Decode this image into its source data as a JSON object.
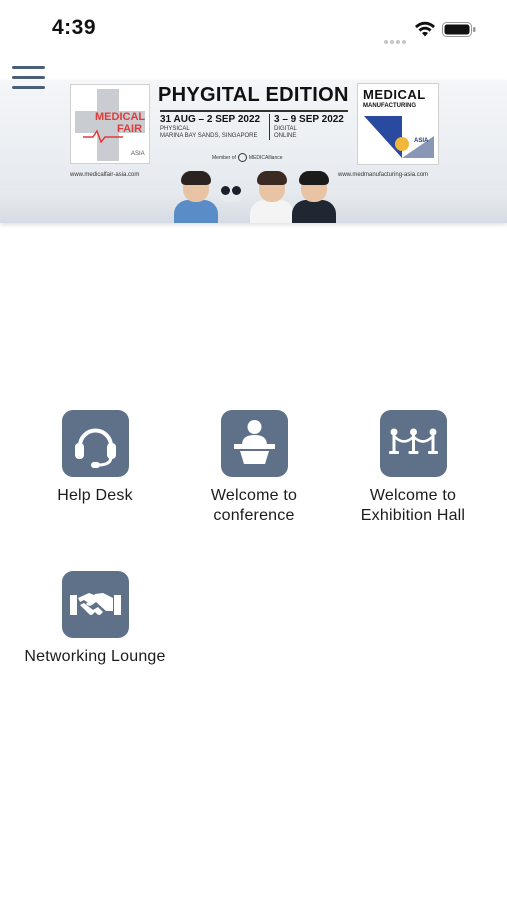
{
  "status_bar": {
    "time": "4:39",
    "icons": [
      "signal-dots-icon",
      "wifi-icon",
      "battery-icon"
    ]
  },
  "header": {
    "menu_icon": "hamburger-menu-icon"
  },
  "banner": {
    "left_logo": {
      "line1": "MEDICAL",
      "line2": "FAIR",
      "line3": "ASIA",
      "url": "www.medicalfair-asia.com"
    },
    "edition_title": "PHYGITAL EDITION",
    "physical": {
      "dates": "31 AUG – 2 SEP 2022",
      "line1": "PHYSICAL",
      "line2": "MARINA BAY SANDS, SINGAPORE"
    },
    "digital": {
      "dates": "3 – 9 SEP 2022",
      "line1": "DIGITAL",
      "line2": "ONLINE"
    },
    "member_text": "Member of",
    "member_brand": "MEDICAlliance",
    "right_logo": {
      "line1": "MEDICAL",
      "line2": "MANUFACTURING",
      "line3": "ASIA",
      "url": "www.medmanufacturing-asia.com"
    }
  },
  "menu_tiles": [
    {
      "label": "Help Desk",
      "icon": "headset-icon"
    },
    {
      "label_line1": "Welcome to",
      "label_line2": "conference",
      "icon": "podium-speaker-icon"
    },
    {
      "label_line1": "Welcome to",
      "label_line2": "Exhibition Hall",
      "icon": "stanchion-rope-icon"
    },
    {
      "label": "Networking Lounge",
      "icon": "handshake-icon"
    }
  ],
  "colors": {
    "tile_background": "#5f7188",
    "menu_icon": "#4a6078",
    "accent_red": "#e23a3a",
    "accent_navy": "#223a7a"
  }
}
